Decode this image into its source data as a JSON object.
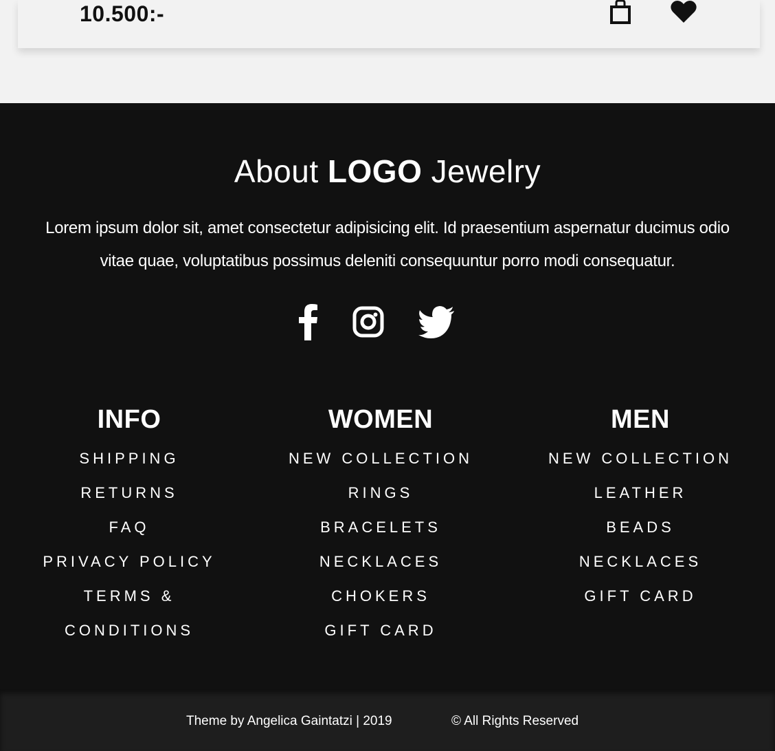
{
  "product": {
    "price": "10.500:-",
    "cart_icon": "shopping-bag-icon",
    "favorite_icon": "heart-icon"
  },
  "footer": {
    "about_prefix": "About",
    "about_brand": "LOGO",
    "about_suffix": "Jewelry",
    "about_text": "Lorem ipsum dolor sit, amet consectetur adipisicing elit. Id praesentium aspernatur ducimus odio vitae quae, voluptatibus possimus deleniti consequuntur porro modi consequatur.",
    "social": [
      "facebook-icon",
      "instagram-icon",
      "twitter-icon"
    ],
    "columns": {
      "info": {
        "title": "INFO",
        "items": [
          "SHIPPING",
          "RETURNS",
          "FAQ",
          "PRIVACY POLICY",
          "TERMS & CONDITIONS"
        ]
      },
      "women": {
        "title": "WOMEN",
        "items": [
          "NEW COLLECTION",
          "RINGS",
          "BRACELETS",
          "NECKLACES",
          "CHOKERS",
          "GIFT CARD"
        ]
      },
      "men": {
        "title": "MEN",
        "items": [
          "NEW COLLECTION",
          "LEATHER",
          "BEADS",
          "NECKLACES",
          "GIFT CARD"
        ]
      }
    }
  },
  "bottom_bar": {
    "credit": "Theme by Angelica Gaintatzi | 2019",
    "rights": "© All Rights Reserved"
  },
  "colors": {
    "page_bg": "#f2f2f2",
    "footer_bg": "#111111",
    "bottom_bar_bg": "#1e1e1e",
    "text_light": "#ffffff",
    "text_dark": "#111111"
  }
}
